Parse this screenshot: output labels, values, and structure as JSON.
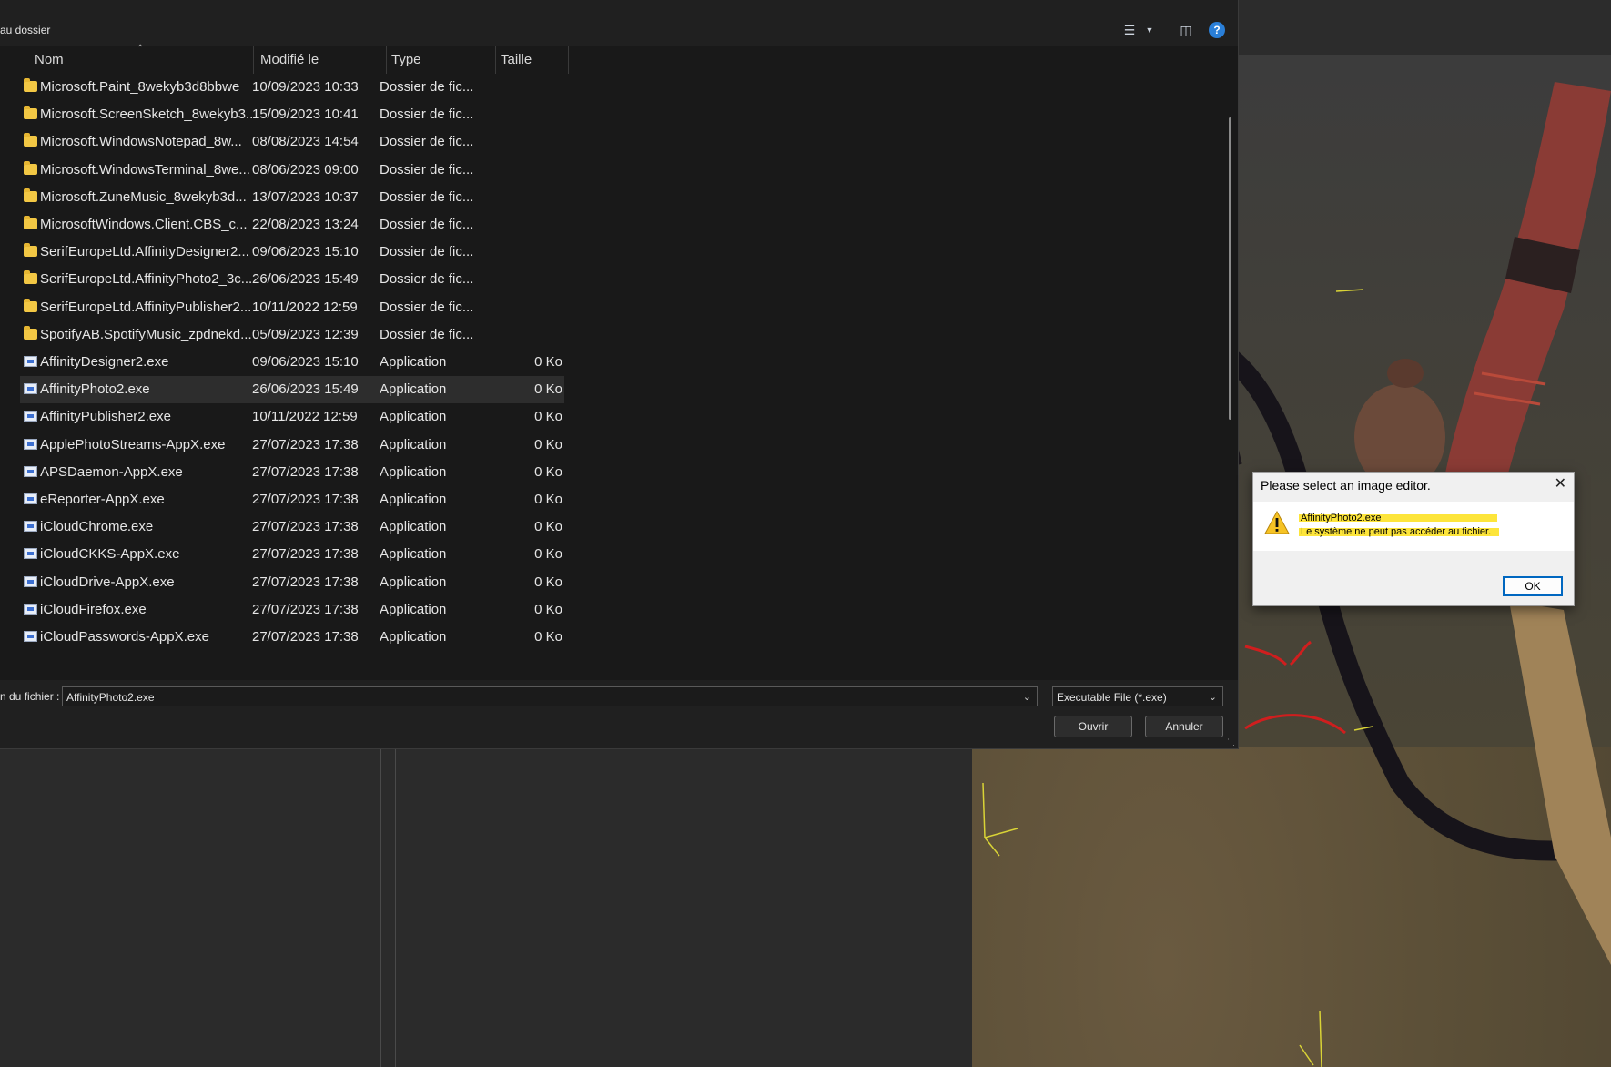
{
  "breadcrumb": "au dossier",
  "toolbar": {
    "view_icon": "list-view-icon",
    "pane_icon": "preview-pane-icon",
    "help_icon": "help-icon"
  },
  "columns": {
    "name": "Nom",
    "modified": "Modifié le",
    "type": "Type",
    "size": "Taille"
  },
  "files": [
    {
      "name": "Microsoft.Paint_8wekyb3d8bbwe",
      "modified": "10/09/2023 10:33",
      "type": "Dossier de fic...",
      "size": "",
      "kind": "folder"
    },
    {
      "name": "Microsoft.ScreenSketch_8wekyb3...",
      "modified": "15/09/2023 10:41",
      "type": "Dossier de fic...",
      "size": "",
      "kind": "folder"
    },
    {
      "name": "Microsoft.WindowsNotepad_8w...",
      "modified": "08/08/2023 14:54",
      "type": "Dossier de fic...",
      "size": "",
      "kind": "folder"
    },
    {
      "name": "Microsoft.WindowsTerminal_8we...",
      "modified": "08/06/2023 09:00",
      "type": "Dossier de fic...",
      "size": "",
      "kind": "folder"
    },
    {
      "name": "Microsoft.ZuneMusic_8wekyb3d...",
      "modified": "13/07/2023 10:37",
      "type": "Dossier de fic...",
      "size": "",
      "kind": "folder"
    },
    {
      "name": "MicrosoftWindows.Client.CBS_c...",
      "modified": "22/08/2023 13:24",
      "type": "Dossier de fic...",
      "size": "",
      "kind": "folder"
    },
    {
      "name": "SerifEuropeLtd.AffinityDesigner2...",
      "modified": "09/06/2023 15:10",
      "type": "Dossier de fic...",
      "size": "",
      "kind": "folder"
    },
    {
      "name": "SerifEuropeLtd.AffinityPhoto2_3c...",
      "modified": "26/06/2023 15:49",
      "type": "Dossier de fic...",
      "size": "",
      "kind": "folder"
    },
    {
      "name": "SerifEuropeLtd.AffinityPublisher2...",
      "modified": "10/11/2022 12:59",
      "type": "Dossier de fic...",
      "size": "",
      "kind": "folder"
    },
    {
      "name": "SpotifyAB.SpotifyMusic_zpdnekd...",
      "modified": "05/09/2023 12:39",
      "type": "Dossier de fic...",
      "size": "",
      "kind": "folder"
    },
    {
      "name": "AffinityDesigner2.exe",
      "modified": "09/06/2023 15:10",
      "type": "Application",
      "size": "0 Ko",
      "kind": "exe"
    },
    {
      "name": "AffinityPhoto2.exe",
      "modified": "26/06/2023 15:49",
      "type": "Application",
      "size": "0 Ko",
      "kind": "exe",
      "selected": true
    },
    {
      "name": "AffinityPublisher2.exe",
      "modified": "10/11/2022 12:59",
      "type": "Application",
      "size": "0 Ko",
      "kind": "exe"
    },
    {
      "name": "ApplePhotoStreams-AppX.exe",
      "modified": "27/07/2023 17:38",
      "type": "Application",
      "size": "0 Ko",
      "kind": "exe"
    },
    {
      "name": "APSDaemon-AppX.exe",
      "modified": "27/07/2023 17:38",
      "type": "Application",
      "size": "0 Ko",
      "kind": "exe"
    },
    {
      "name": "eReporter-AppX.exe",
      "modified": "27/07/2023 17:38",
      "type": "Application",
      "size": "0 Ko",
      "kind": "exe"
    },
    {
      "name": "iCloudChrome.exe",
      "modified": "27/07/2023 17:38",
      "type": "Application",
      "size": "0 Ko",
      "kind": "exe"
    },
    {
      "name": "iCloudCKKS-AppX.exe",
      "modified": "27/07/2023 17:38",
      "type": "Application",
      "size": "0 Ko",
      "kind": "exe"
    },
    {
      "name": "iCloudDrive-AppX.exe",
      "modified": "27/07/2023 17:38",
      "type": "Application",
      "size": "0 Ko",
      "kind": "exe"
    },
    {
      "name": "iCloudFirefox.exe",
      "modified": "27/07/2023 17:38",
      "type": "Application",
      "size": "0 Ko",
      "kind": "exe"
    },
    {
      "name": "iCloudPasswords-AppX.exe",
      "modified": "27/07/2023 17:38",
      "type": "Application",
      "size": "0 Ko",
      "kind": "exe"
    }
  ],
  "footer": {
    "filename_label": "n du fichier :",
    "filename_value": "AffinityPhoto2.exe",
    "filetype_value": "Executable File (*.exe)",
    "open_label": "Ouvrir",
    "cancel_label": "Annuler"
  },
  "message_box": {
    "title": "Please select an image editor.",
    "line1": "AffinityPhoto2.exe",
    "line2": "Le système ne peut pas accéder au fichier.",
    "ok_label": "OK",
    "icon": "warning-icon",
    "highlight_color": "#fde53b"
  },
  "colors": {
    "selection": "#2d2d2d",
    "accent": "#0067c0"
  }
}
